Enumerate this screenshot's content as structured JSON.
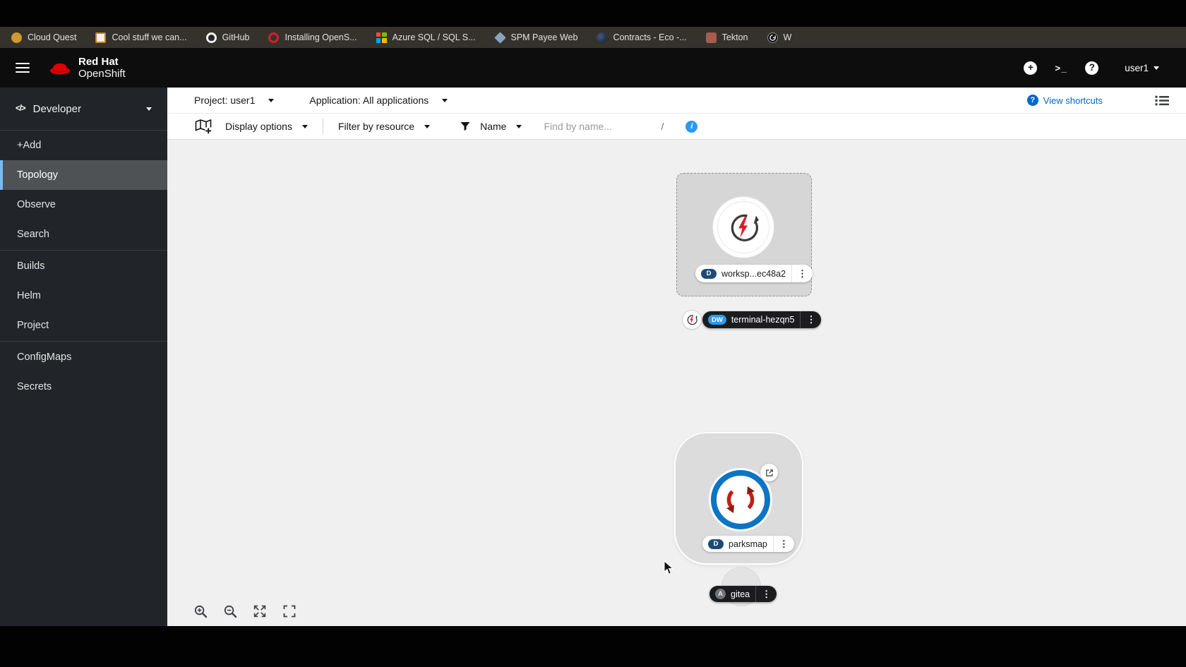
{
  "bookmarks": {
    "items": [
      "Cloud Quest",
      "Cool stuff we can...",
      "GitHub",
      "Installing OpenS...",
      "Azure SQL / SQL S...",
      "SPM Payee Web",
      "Contracts - Eco -...",
      "Tekton",
      "W"
    ]
  },
  "masthead": {
    "brand_line1": "Red Hat",
    "brand_line2": "OpenShift",
    "plus_glyph": "+",
    "terminal_glyph": ">_",
    "help_glyph": "?",
    "user": "user1"
  },
  "sidebar": {
    "code_icon": "</>",
    "perspective": "Developer",
    "groups": [
      [
        "+Add",
        "Topology",
        "Observe",
        "Search"
      ],
      [
        "Builds",
        "Helm",
        "Project"
      ],
      [
        "ConfigMaps",
        "Secrets"
      ]
    ],
    "active_item": "Topology"
  },
  "context_bar": {
    "project": "Project: user1",
    "application": "Application: All applications",
    "help_glyph": "?",
    "shortcuts": "View shortcuts"
  },
  "filter_bar": {
    "display_options": "Display options",
    "filter_by_resource": "Filter by resource",
    "name": "Name",
    "placeholder": "Find by name...",
    "slash": "/",
    "info_glyph": "i"
  },
  "topology": {
    "workspace": {
      "badge": "D",
      "label": "worksp...ec48a2"
    },
    "terminal": {
      "badge": "DW",
      "label": "terminal-hezqn5"
    },
    "parksmap": {
      "badge": "D",
      "label": "parksmap"
    },
    "gitea": {
      "badge": "A",
      "label": "gitea"
    }
  },
  "ui": {
    "kebab": "⋮"
  },
  "colors": {
    "masthead_bg": "#0d0d0d",
    "sidebar_bg": "#212529",
    "canvas_bg": "#f0f0f1",
    "link_blue": "#0066cc",
    "accent_blue": "#2b9af3",
    "node_ring_blue": "#0d74c4",
    "redhat_red": "#ee0000",
    "badge_navy": "#1c4b74",
    "selected_nav_bg": "#4f5255",
    "selected_nav_border": "#73bcf7"
  }
}
